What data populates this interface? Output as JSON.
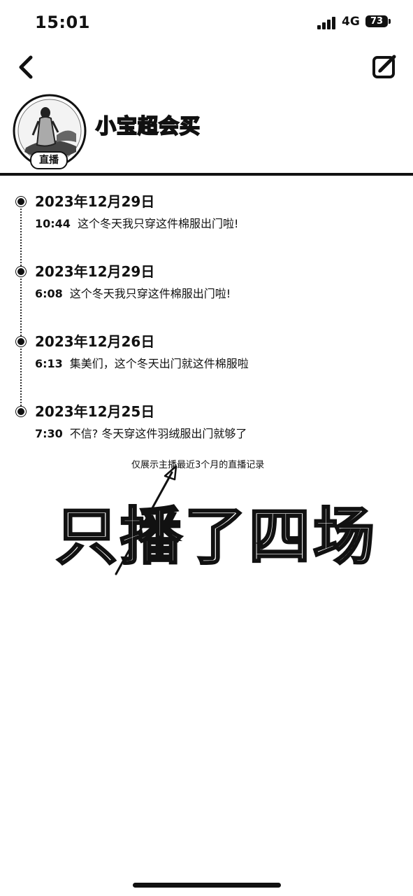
{
  "status_bar": {
    "time": "15:01",
    "network": "4G",
    "battery": "73"
  },
  "header": {
    "back_icon": "chevron-left-icon",
    "edit_icon": "edit-square-icon",
    "anchor_name": "小宝超会买",
    "live_badge": "直播"
  },
  "records": [
    {
      "date": "2023年12月29日",
      "time": "10:44",
      "title": "这个冬天我只穿这件棉服出门啦!"
    },
    {
      "date": "2023年12月29日",
      "time": "6:08",
      "title": "这个冬天我只穿这件棉服出门啦!"
    },
    {
      "date": "2023年12月26日",
      "time": "6:13",
      "title": "集美们，这个冬天出门就这件棉服啦"
    },
    {
      "date": "2023年12月25日",
      "time": "7:30",
      "title": "不信? 冬天穿这件羽绒服出门就够了"
    }
  ],
  "footnote": "仅展示主播最近3个月的直播记录",
  "annotation": "只播了四场"
}
